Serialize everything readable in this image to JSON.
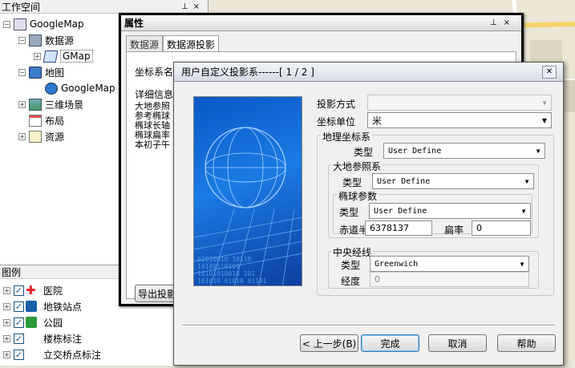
{
  "workspace": {
    "title": "工作空间",
    "tree": {
      "root": "GoogleMap",
      "datasource": "数据源",
      "gmap": "GMap",
      "map": "地图",
      "googlemap": "GoogleMap",
      "scene": "三维场景",
      "layout": "布局",
      "resource": "资源"
    }
  },
  "legend": {
    "title": "图例",
    "items": [
      "医院",
      "地铁站点",
      "公园",
      "楼栋标注",
      "立交桥点标注"
    ]
  },
  "properties": {
    "title": "属性",
    "tabs": [
      "数据源",
      "数据源投影"
    ],
    "coord_name_label": "坐标系名",
    "detail_label": "详细信息",
    "detail_lines": [
      "大地参照",
      "参考椭球",
      "椭球长轴",
      "椭球扁率",
      "本初子午"
    ],
    "export_label": "导出投影"
  },
  "dialog": {
    "title": "用户自定义投影系------[ 1 / 2 ]",
    "projection_mode_label": "投影方式",
    "projection_mode_value": "",
    "coord_unit_label": "坐标单位",
    "coord_unit_value": "米",
    "geo_coord_group": "地理坐标系",
    "type_label": "类型",
    "geo_type_value": "User Define",
    "datum_group": "大地参照系",
    "datum_type_value": "User Define",
    "ellipsoid_group": "椭球参数",
    "ellipsoid_type_value": "User Define",
    "equator_radius_label": "赤道半径",
    "equator_radius_value": "6378137",
    "flattening_label": "扁率",
    "flattening_value": "0",
    "meridian_group": "中央经线",
    "meridian_type_value": "Greenwich",
    "longitude_label": "经度",
    "longitude_value": "0",
    "buttons": {
      "prev": "< 上一步(B)",
      "finish": "完成",
      "cancel": "取消",
      "help": "帮助"
    },
    "banner_digits": [
      "01010010 10110",
      "10100110101",
      "10101010010 101",
      "101010 01010 01101"
    ]
  }
}
